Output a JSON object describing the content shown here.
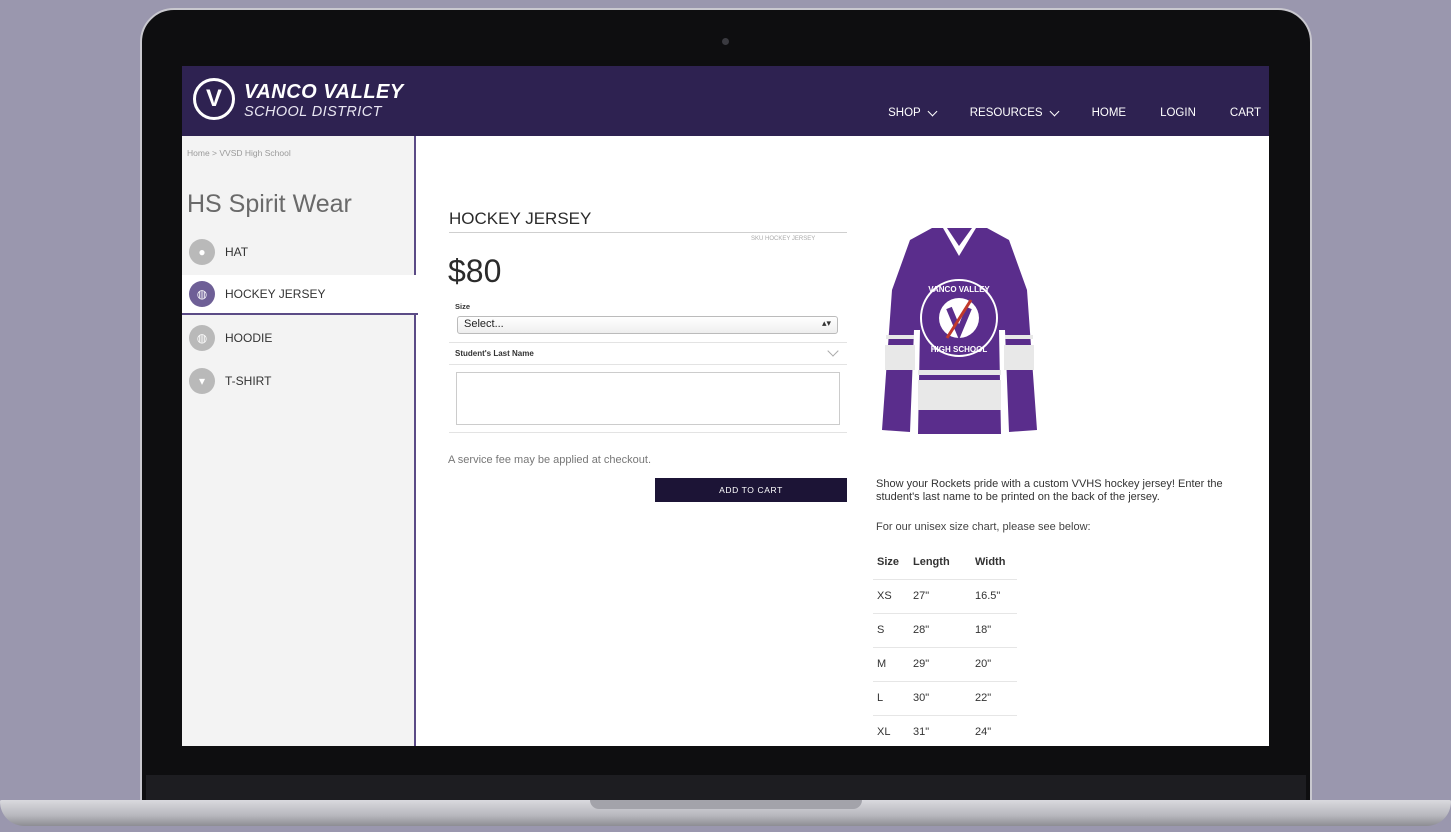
{
  "brand": {
    "logo_letter": "V",
    "name_line1": "VANCO VALLEY",
    "name_line2": "SCHOOL DISTRICT"
  },
  "nav": {
    "shop": "SHOP",
    "resources": "RESOURCES",
    "home": "HOME",
    "login": "LOGIN",
    "cart": "CART"
  },
  "sidebar": {
    "breadcrumb": "Home > VVSD High School",
    "title": "HS Spirit Wear",
    "items": [
      {
        "label": "HAT",
        "icon": "hat-icon"
      },
      {
        "label": "HOCKEY JERSEY",
        "icon": "jersey-icon",
        "active": true
      },
      {
        "label": "HOODIE",
        "icon": "hoodie-icon"
      },
      {
        "label": "T-SHIRT",
        "icon": "tshirt-icon"
      }
    ]
  },
  "product": {
    "title": "HOCKEY JERSEY",
    "sku": "SKU HOCKEY JERSEY",
    "price": "$80",
    "size_label": "Size",
    "size_value": "Select...",
    "last_name_label": "Student's Last Name",
    "last_name_value": "",
    "fee_note": "A service fee may be applied at checkout.",
    "add_to_cart": "ADD TO CART",
    "image_text_top": "VANCO VALLEY",
    "image_text_bottom": "HIGH SCHOOL",
    "description": "Show your Rockets pride with a custom VVHS hockey jersey! Enter the student's last name to be printed on the back of the jersey.",
    "size_chart_note": "For our unisex size chart, please see below:"
  },
  "size_chart": {
    "headers": [
      "Size",
      "Length",
      "Width"
    ],
    "rows": [
      [
        "XS",
        "27\"",
        "16.5\""
      ],
      [
        "S",
        "28\"",
        "18\""
      ],
      [
        "M",
        "29\"",
        "20\""
      ],
      [
        "L",
        "30\"",
        "22\""
      ],
      [
        "XL",
        "31\"",
        "24\""
      ]
    ]
  },
  "colors": {
    "brand_purple": "#2e2251",
    "button": "#1c1436",
    "jersey": "#5a2d8c"
  }
}
